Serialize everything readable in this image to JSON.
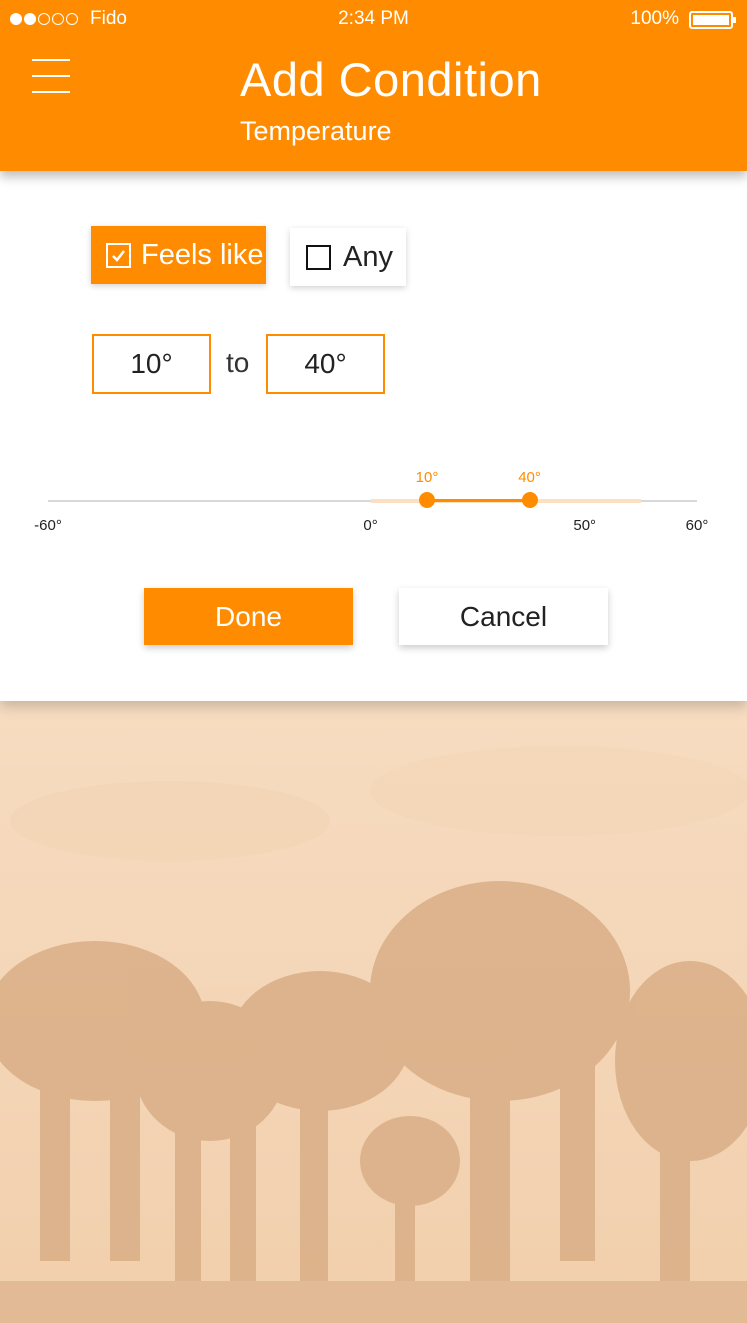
{
  "status_bar": {
    "signal_bars": 2,
    "carrier": "Fido",
    "time": "2:34 PM",
    "battery": "100%"
  },
  "header": {
    "title": "Add Condition",
    "subtitle": "Temperature"
  },
  "options": {
    "feels_like": {
      "label": "Feels like",
      "checked": true
    },
    "any": {
      "label": "Any",
      "checked": false
    }
  },
  "range": {
    "from": "10°",
    "to_label": "to",
    "to": "40°"
  },
  "slider": {
    "min": -60,
    "max": 60,
    "low_value": 10,
    "high_value": 40,
    "low_label": "10°",
    "high_label": "40°",
    "ticks": [
      {
        "label": "-60°"
      },
      {
        "label": "0°"
      },
      {
        "label": "50°"
      },
      {
        "label": "60°"
      }
    ]
  },
  "buttons": {
    "done": "Done",
    "cancel": "Cancel"
  },
  "colors": {
    "accent": "#ff8c00",
    "background_tint": "#f6d9bb"
  }
}
